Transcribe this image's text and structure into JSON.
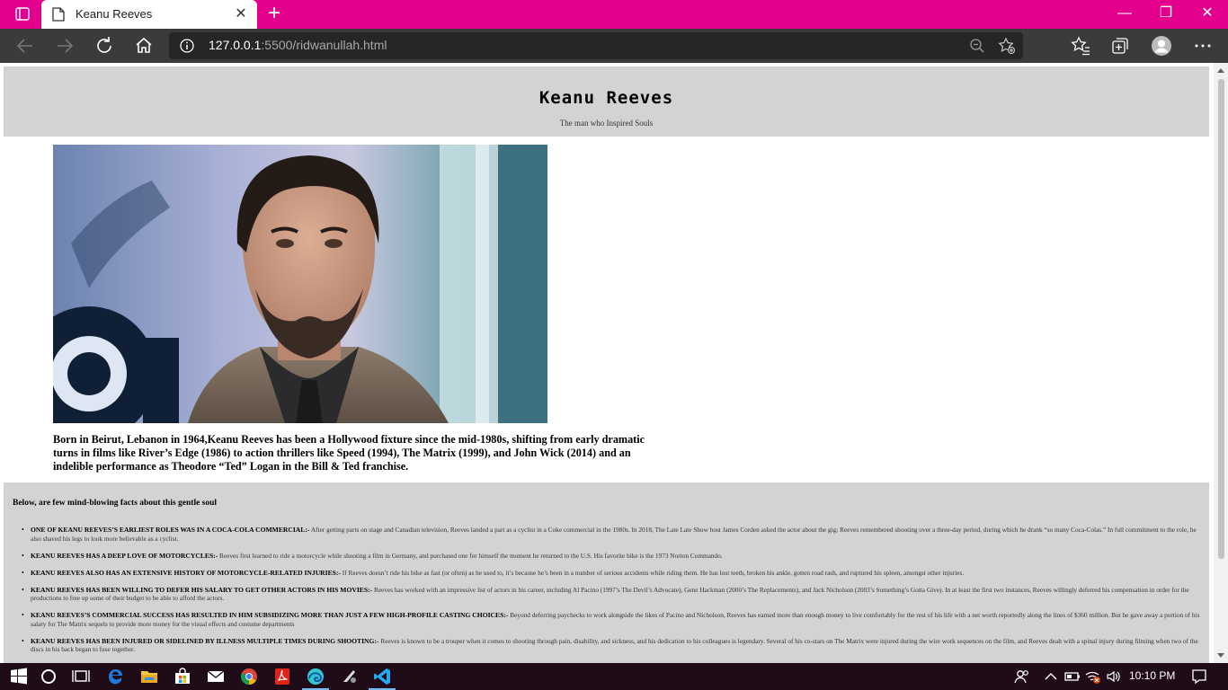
{
  "browser": {
    "tab_title": "Keanu Reeves",
    "url_host": "127.0.0.1",
    "url_rest": ":5500/ridwanullah.html",
    "accent_color": "#e3008c"
  },
  "page": {
    "title": "Keanu  Reeves",
    "subtitle": "The man who Inspired Souls",
    "intro": "Born in Beirut, Lebanon in 1964,Keanu Reeves has been a Hollywood fixture since the mid-1980s, shifting from early dramatic turns in films like River’s Edge (1986) to action thrillers like Speed (1994), The Matrix (1999), and John Wick (2014) and an indelible performance as Theodore “Ted” Logan in the Bill & Ted franchise.",
    "facts_heading": "Below, are few mind-blowing facts about this gentle soul",
    "facts": [
      {
        "title": "ONE OF KEANU REEVES’S EARLIEST ROLES WAS IN A COCA-COLA COMMERCIAL:-",
        "text": " After getting parts on stage and Canadian television, Reeves landed a part as a cyclist in a Coke commercial in the 1980s. In 2018, The Late Late Show host James Corden asked the actor about the gig; Reeves remembered shooting over a three-day period, during which he drank “so many Coca-Colas.” In full commitment to the role, he also shaved his legs to look more believable as a cyclist."
      },
      {
        "title": "KEANU REEVES HAS A DEEP LOVE OF MOTORCYCLES:-",
        "text": " Reeves first learned to ride a motorcycle while shooting a film in Germany, and purchased one for himself the moment he returned to the U.S. His favorite bike is the 1973 Norton Commando."
      },
      {
        "title": "KEANU REEVES ALSO HAS AN EXTENSIVE HISTORY OF MOTORCYCLE-RELATED INJURIES:-",
        "text": " If Reeves doesn’t ride his bike as fast (or often) as he used to, it’s because he’s been in a number of serious accidents while riding them. He has lost teeth, broken his ankle, gotten road rash, and ruptured his spleen, amongst other injuries."
      },
      {
        "title": "KEANU REEVES HAS BEEN WILLING TO DEFER HIS SALARY TO GET OTHER ACTORS IN HIS MOVIES:-",
        "text": " Reeves has worked with an impressive list of actors in his career, including Al Pacino (1997’s The Devil’s Advocate), Gene Hackman (2000’s The Replacements), and Jack Nicholson (2003’s Something’s Gotta Give). In at least the first two instances, Reeves willingly deferred his compensation in order for the productions to free up some of their budget to be able to afford the actors."
      },
      {
        "title": "KEANU REEVES’S COMMERCIAL SUCCESS HAS RESULTED IN HIM SUBSIDIZING MORE THAN JUST A FEW HIGH-PROFILE CASTING CHOICES:-",
        "text": " Beyond deferring paychecks to work alongside the likes of Pacino and Nicholson, Reeves has earned more than enough money to live comfortably for the rest of his life with a net worth reportedly along the lines of $360 million. But he gave away a portion of his salary for The Matrix sequels to provide more money for the visual effects and costume departments"
      },
      {
        "title": "KEANU REEVES HAS BEEN INJURED OR SIDELINED BY ILLNESS MULTIPLE TIMES DURING SHOOTING:-",
        "text": " Reeves is known to be a trouper when it comes to shooting through pain, disability, and sickness, and his dedication to his colleagues is legendary. Several of his co-stars on The Matrix were injured during the wire work sequences on the film, and Reeves dealt with a spinal injury during filming when two of the discs in his back began to fuse together."
      }
    ]
  },
  "taskbar": {
    "clock": "10:10 PM"
  }
}
